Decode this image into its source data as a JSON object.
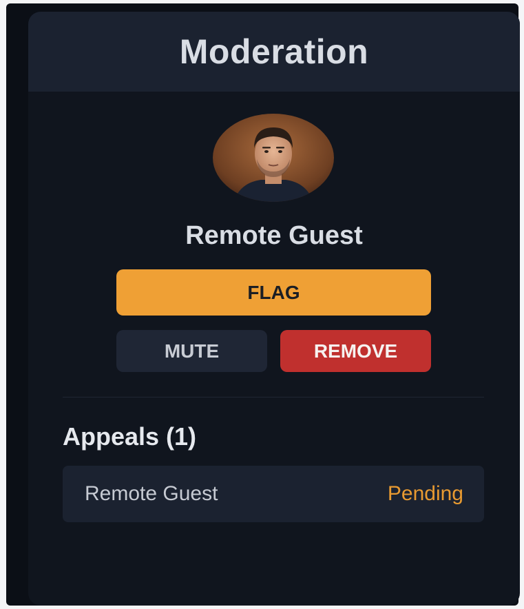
{
  "panel": {
    "title": "Moderation"
  },
  "participant": {
    "name": "Remote Guest",
    "avatar_icon": "user-avatar-photo"
  },
  "actions": {
    "flag_label": "FLAG",
    "mute_label": "MUTE",
    "remove_label": "REMOVE"
  },
  "appeals": {
    "heading": "Appeals (1)",
    "items": [
      {
        "name": "Remote Guest",
        "status": "Pending"
      }
    ]
  },
  "colors": {
    "accent_flag": "#efa035",
    "danger_remove": "#c0302e",
    "status_pending": "#e89a31",
    "panel_bg": "#10151e",
    "header_bg": "#1b2230"
  }
}
